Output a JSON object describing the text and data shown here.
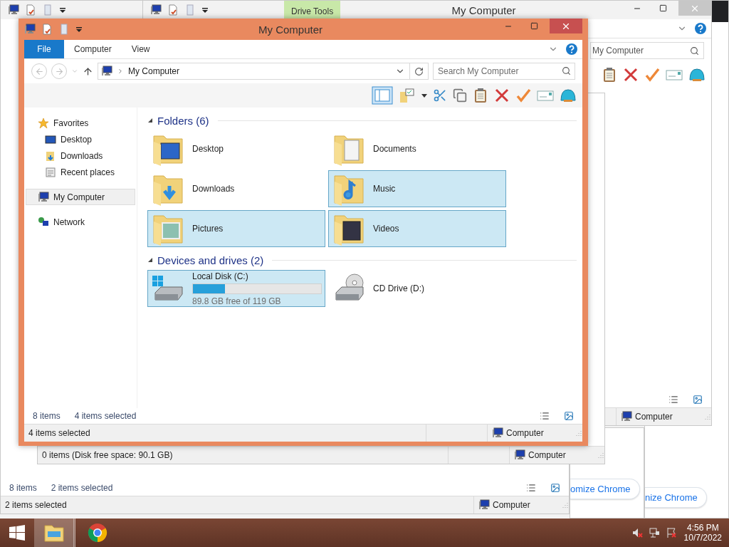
{
  "chrome_windows": [
    {
      "button": "nize Chrome"
    },
    {
      "button": "omize Chrome"
    }
  ],
  "back_window_left": {
    "item_count": "8 items",
    "selection_count": "2 items selected",
    "status_text": "2 items selected",
    "status_location": "Computer"
  },
  "back_window_right": {
    "contextual_tab": "Drive Tools",
    "title": "My Computer",
    "search_value": "My Computer",
    "status_location": "Computer"
  },
  "back_window_middle": {
    "status_text": "0 items (Disk free space: 90.1 GB)",
    "status_location": "Computer"
  },
  "window": {
    "title": "My Computer",
    "ribbon_tabs": [
      {
        "label": "File",
        "selected": true
      },
      {
        "label": "Computer",
        "selected": false
      },
      {
        "label": "View",
        "selected": false
      }
    ],
    "address": "My Computer",
    "search": {
      "placeholder": "Search My Computer"
    },
    "navigation": [
      {
        "label": "Favorites",
        "kind": "star",
        "selected": false,
        "children": [
          {
            "label": "Desktop",
            "kind": "desktop",
            "selected": false
          },
          {
            "label": "Downloads",
            "kind": "downloads",
            "selected": false
          },
          {
            "label": "Recent places",
            "kind": "recent",
            "selected": false
          }
        ]
      },
      {
        "label": "My Computer",
        "kind": "computer",
        "selected": true
      },
      {
        "label": "Network",
        "kind": "network",
        "selected": false
      }
    ],
    "groups": [
      {
        "title": "Folders (6)",
        "items": [
          {
            "name": "Desktop",
            "kind": "desktop",
            "selected": false
          },
          {
            "name": "Documents",
            "kind": "documents",
            "selected": false
          },
          {
            "name": "Downloads",
            "kind": "downloads",
            "selected": false
          },
          {
            "name": "Music",
            "kind": "music",
            "selected": true
          },
          {
            "name": "Pictures",
            "kind": "pictures",
            "selected": true
          },
          {
            "name": "Videos",
            "kind": "videos",
            "selected": true
          }
        ]
      },
      {
        "title": "Devices and drives (2)",
        "items": [
          {
            "name": "Local Disk (C:)",
            "kind": "disk",
            "selected": true,
            "level": 0.25,
            "detail": "89.8 GB free of 119 GB"
          },
          {
            "name": "CD Drive (D:)",
            "kind": "cd",
            "selected": false
          }
        ]
      }
    ],
    "item_count": "8 items",
    "selection_count": "4 items selected",
    "status_text": "4 items selected",
    "status_location": "Computer"
  },
  "taskbar": {
    "apps": [
      {
        "kind": "explorer",
        "selected": true
      },
      {
        "kind": "chrome",
        "selected": false
      }
    ],
    "time": "4:56 PM",
    "date": "10/7/2022"
  }
}
